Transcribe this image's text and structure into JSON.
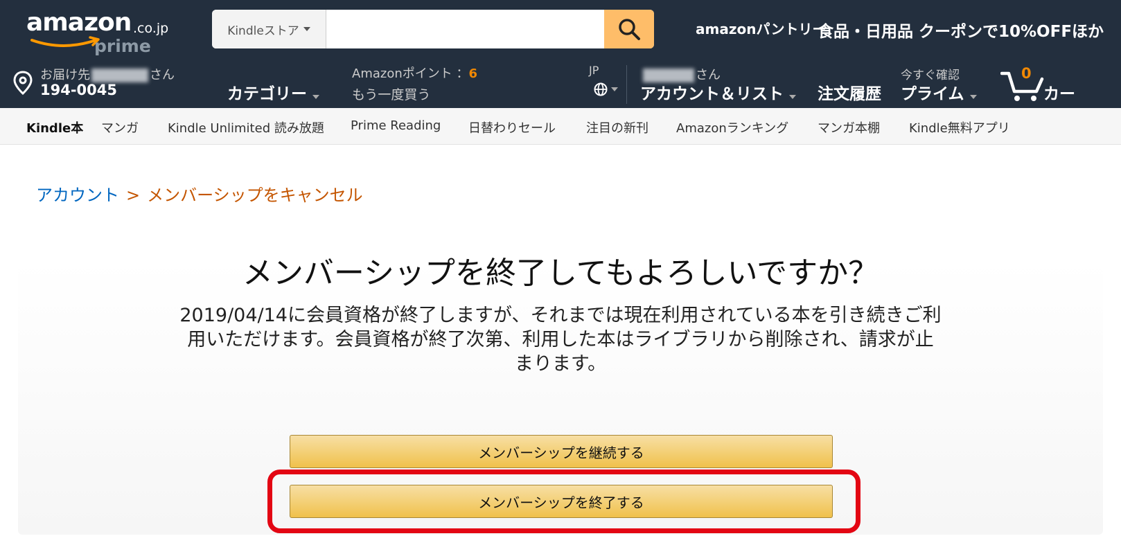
{
  "header": {
    "logo_main": "amazon",
    "logo_domain": ".co.jp",
    "logo_sub": "prime",
    "search": {
      "department": "Kindleストア",
      "value": "",
      "placeholder": ""
    },
    "pantry": "amazonパントリー",
    "promo": "食品・日用品 クーポンで10%OFFほか"
  },
  "navbar": {
    "address_prefix": "お届け先",
    "address_suffix": "さん",
    "address_zip": "194-0045",
    "category": "カテゴリー",
    "points_label": "Amazonポイント ：",
    "points_value": "6",
    "rebuy": "もう一度買う",
    "language": "JP",
    "account_suffix": "さん",
    "account": "アカウント＆リスト",
    "orders": "注文履歴",
    "prime_top": "今すぐ確認",
    "prime": "プライム",
    "cart_count": "0",
    "cart": "カート"
  },
  "subnav": [
    "Kindle本",
    "マンガ",
    "Kindle Unlimited 読み放題",
    "Prime Reading",
    "日替わりセール",
    "注目の新刊",
    "Amazonランキング",
    "マンガ本棚",
    "Kindle無料アプリ"
  ],
  "breadcrumb": {
    "link": "アカウント",
    "separator": ">",
    "current": "メンバーシップをキャンセル"
  },
  "main": {
    "title": "メンバーシップを終了してもよろしいですか？",
    "description": "2019/04/14に会員資格が終了しますが、それまでは現在利用されている本を引き続きご利用いただけます。会員資格が終了次第、利用した本はライブラリから削除され、請求が止まります。",
    "continue_button": "メンバーシップを継続する",
    "end_button": "メンバーシップを終了する"
  },
  "colors": {
    "header_bg": "#232f3e",
    "search_button": "#febd69",
    "accent_orange": "#f08804",
    "link_blue": "#0066c0",
    "breadcrumb_current": "#c45500",
    "button_fill": "#f0c14b",
    "highlight_red": "#e30613"
  }
}
